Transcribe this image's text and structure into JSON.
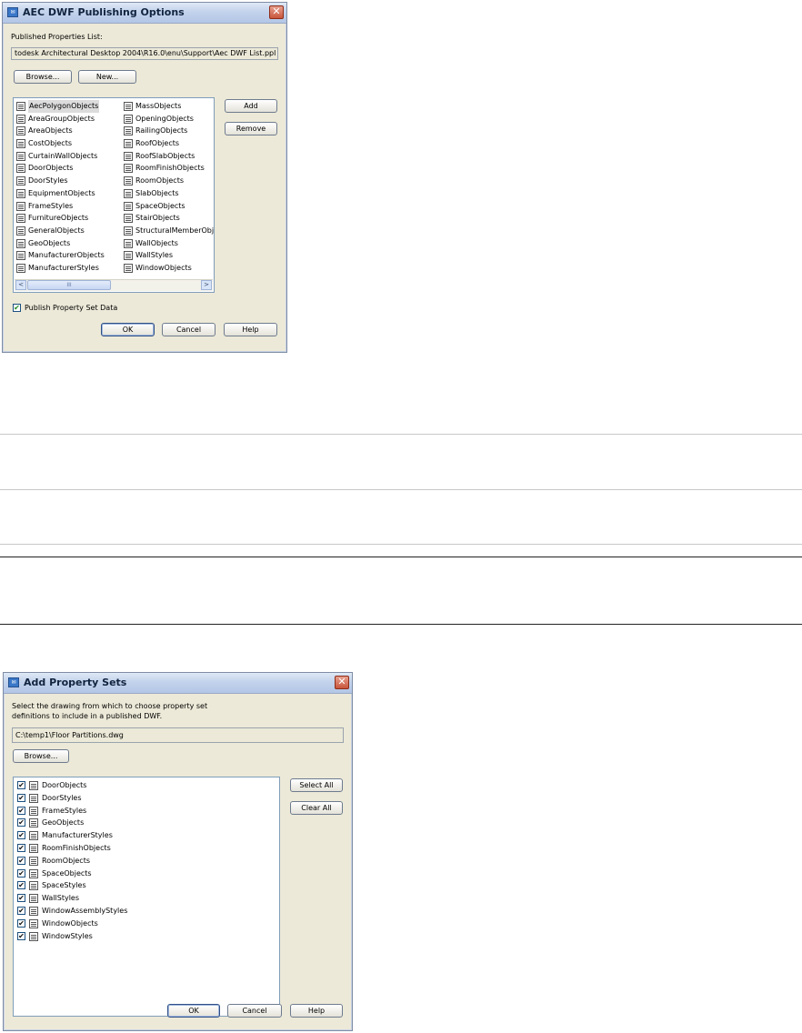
{
  "dialog1": {
    "title": "AEC DWF Publishing Options",
    "close_glyph": "✕",
    "published_list_label": "Published Properties List:",
    "published_list_path": "todesk Architectural Desktop 2004\\R16.0\\enu\\Support\\Aec DWF List.ppl",
    "browse_label": "Browse...",
    "new_label": "New...",
    "add_label": "Add",
    "remove_label": "Remove",
    "objects_col1": [
      "AecPolygonObjects",
      "AreaGroupObjects",
      "AreaObjects",
      "CostObjects",
      "CurtainWallObjects",
      "DoorObjects",
      "DoorStyles",
      "EquipmentObjects",
      "FrameStyles",
      "FurnitureObjects",
      "GeneralObjects",
      "GeoObjects",
      "ManufacturerObjects",
      "ManufacturerStyles"
    ],
    "objects_col2": [
      "MassObjects",
      "OpeningObjects",
      "RailingObjects",
      "RoofObjects",
      "RoofSlabObjects",
      "RoomFinishObjects",
      "RoomObjects",
      "SlabObjects",
      "SpaceObjects",
      "StairObjects",
      "StructuralMemberObje",
      "WallObjects",
      "WallStyles",
      "WindowObjects"
    ],
    "scroll_left_glyph": "<",
    "scroll_right_glyph": ">",
    "scroll_thumb_grip": "III",
    "publish_psd_label": "Publish Property Set Data",
    "publish_psd_checked": true,
    "ok_label": "OK",
    "cancel_label": "Cancel",
    "help_label": "Help"
  },
  "dialog2": {
    "title": "Add Property Sets",
    "close_glyph": "✕",
    "instruction_line1": "Select the drawing from which to choose property set",
    "instruction_line2": "definitions to include in a published DWF.",
    "drawing_path": "C:\\temp1\\Floor Partitions.dwg",
    "browse_label": "Browse...",
    "select_all_label": "Select All",
    "clear_all_label": "Clear All",
    "property_sets": [
      "DoorObjects",
      "DoorStyles",
      "FrameStyles",
      "GeoObjects",
      "ManufacturerStyles",
      "RoomFinishObjects",
      "RoomObjects",
      "SpaceObjects",
      "SpaceStyles",
      "WallStyles",
      "WindowAssemblyStyles",
      "WindowObjects",
      "WindowStyles"
    ],
    "check_glyph": "✔",
    "ok_label": "OK",
    "cancel_label": "Cancel",
    "help_label": "Help"
  },
  "colors": {
    "dialog_bg": "#ece9d8",
    "titlebar": "#c3d3ec",
    "rule_light": "#c8c8c8",
    "rule_dark": "#222222"
  },
  "icons": {
    "title_icon": "app-icon",
    "list_item_icon": "property-set-icon"
  }
}
